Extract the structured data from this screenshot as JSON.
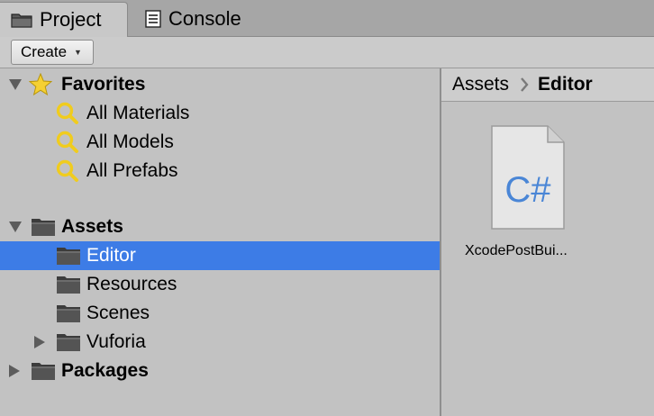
{
  "tabs": [
    {
      "label": "Project",
      "icon": "folder-icon",
      "active": true
    },
    {
      "label": "Console",
      "icon": "console-icon",
      "active": false
    }
  ],
  "toolbar": {
    "create_label": "Create"
  },
  "tree": {
    "favorites": {
      "label": "Favorites",
      "items": [
        "All Materials",
        "All Models",
        "All Prefabs"
      ]
    },
    "assets": {
      "label": "Assets",
      "items": [
        "Editor",
        "Resources",
        "Scenes",
        "Vuforia"
      ]
    },
    "packages": {
      "label": "Packages"
    }
  },
  "breadcrumb": {
    "root": "Assets",
    "current": "Editor"
  },
  "assets_view": {
    "files": [
      {
        "name": "XcodePostBui...",
        "type": "C#"
      }
    ]
  },
  "colors": {
    "selection": "#3d7ce6",
    "panel_bg": "#c2c2c2",
    "script_text": "#4a86d6"
  }
}
